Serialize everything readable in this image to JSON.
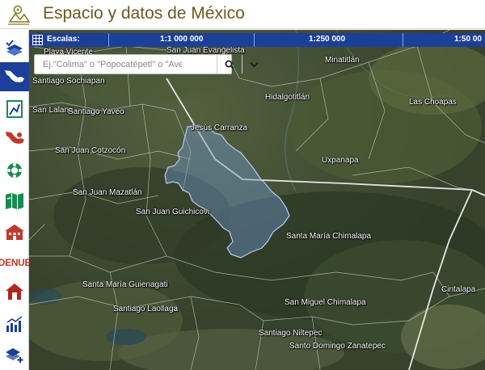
{
  "header": {
    "title": "Espacio y datos de México",
    "logo_icon": "map-pin-compass-icon"
  },
  "sidebar": {
    "items": [
      {
        "name": "layers-check",
        "icon": "layers-check-icon",
        "active": false
      },
      {
        "name": "mexico-map",
        "icon": "mexico-map-icon",
        "active": true
      },
      {
        "name": "road-map",
        "icon": "road-map-icon",
        "active": false
      },
      {
        "name": "mexico-red",
        "icon": "mexico-red-icon",
        "active": false
      },
      {
        "name": "ecology",
        "icon": "ecology-icon",
        "active": false
      },
      {
        "name": "book-map",
        "icon": "book-map-icon",
        "active": false
      },
      {
        "name": "buildings",
        "icon": "buildings-icon",
        "active": false
      },
      {
        "name": "denue",
        "label": "DENUE",
        "active": false
      },
      {
        "name": "home",
        "icon": "home-icon",
        "active": false
      },
      {
        "name": "stats",
        "icon": "stats-icon",
        "active": false
      },
      {
        "name": "add-layer",
        "icon": "add-layer-icon",
        "active": false
      }
    ]
  },
  "scalebar": {
    "label": "Escalas:",
    "scales": [
      "1:1 000 000",
      "1:250 000",
      "1:50 00"
    ]
  },
  "search": {
    "placeholder": "Ej.\"Colima\" o \"Popocatépetl\" o \"Ave"
  },
  "map": {
    "places": [
      "Playa Vicente",
      "San Juan Evangelista",
      "Minatitlán",
      "Santiago Sochiapan",
      "Hidalgotitlán",
      "Las Choapas",
      "San Lalana",
      "Santiago Yaveo",
      "Jesús Carranza",
      "San Juan Cotzocón",
      "Uxpanapa",
      "San Juan Mazatlán",
      "San Juan Guichicovi",
      "Santa María Chimalapa",
      "Santa María Guienagati",
      "Cintalapa",
      "Santiago Laollaga",
      "San Miguel Chimalapa",
      "Santiago Niltepec",
      "Santo Domingo Zanatepec"
    ],
    "colors": {
      "highlight_fill": "#6f95c9",
      "highlight_stroke": "#b9ccef",
      "boundary": "#cfcfcf",
      "state_line": "#e5e5e5"
    }
  }
}
